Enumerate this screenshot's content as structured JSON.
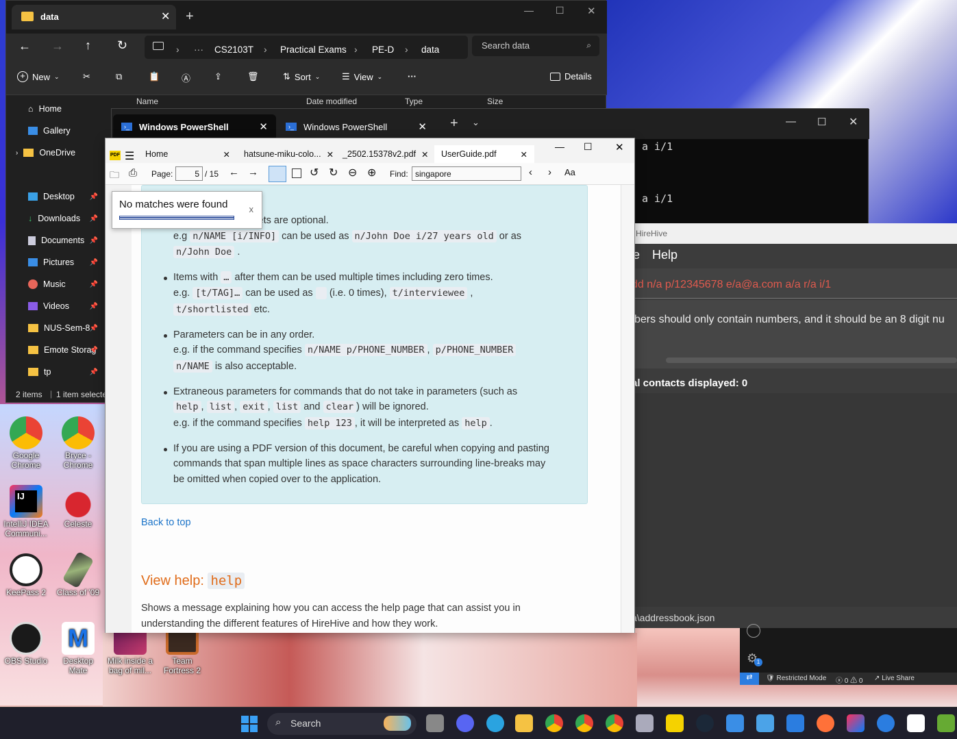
{
  "explorer": {
    "tab_title": "data",
    "breadcrumb": [
      "CS2103T",
      "Practical Exams",
      "PE-D",
      "data"
    ],
    "search_placeholder": "Search data",
    "toolbar": {
      "new": "New",
      "sort": "Sort",
      "view": "View",
      "details": "Details"
    },
    "columns": [
      "Name",
      "Date modified",
      "Type",
      "Size"
    ],
    "sidebar": [
      {
        "label": "Home",
        "icon": "home-icon"
      },
      {
        "label": "Gallery",
        "icon": "gallery-icon"
      },
      {
        "label": "OneDrive",
        "icon": "folder-icon"
      },
      {
        "label": "Desktop",
        "icon": "desktop-icon"
      },
      {
        "label": "Downloads",
        "icon": "download-icon"
      },
      {
        "label": "Documents",
        "icon": "documents-icon"
      },
      {
        "label": "Pictures",
        "icon": "pictures-icon"
      },
      {
        "label": "Music",
        "icon": "music-icon"
      },
      {
        "label": "Videos",
        "icon": "videos-icon"
      },
      {
        "label": "NUS-Sem-8",
        "icon": "folder-icon"
      },
      {
        "label": "Emote Storag",
        "icon": "folder-icon"
      },
      {
        "label": "tp",
        "icon": "folder-icon"
      }
    ],
    "status": {
      "items": "2 items",
      "selected": "1 item selecte"
    }
  },
  "powershell": {
    "tabs": [
      "Windows PowerShell",
      "Windows PowerShell"
    ],
    "lines": [
      "a i/1",
      "a i/1"
    ]
  },
  "hirehive": {
    "title": "HireHive",
    "menu": [
      "e",
      "Help"
    ],
    "command": "dd n/a p/12345678 e/a@a.com a/a r/a i/1",
    "result": "bers should only contain numbers, and it should be an 8 digit nu",
    "count": "al contacts displayed: 0",
    "footer": "a\\addressbook.json"
  },
  "vscode": {
    "restricted": "Restricted Mode",
    "problems": "0 ⚠ 0",
    "live_share": "Live Share",
    "badge": "1"
  },
  "pdf": {
    "tabs": [
      "Home",
      "hatsune-miku-colo...",
      "_2502.15378v2.pdf",
      "UserGuide.pdf"
    ],
    "page_label": "Page:",
    "page_current": "5",
    "page_total": "/ 15",
    "find_label": "Find:",
    "find_value": "singapore",
    "toast": "No matches were found",
    "toast_close": "x",
    "content": {
      "b1_l1": "ckets are optional.",
      "b1_l2_a": "e.g",
      "b1_code1": "n/NAME [i/INFO]",
      "b1_l2_b": "can be used as",
      "b1_code2": "n/John Doe i/27 years old",
      "b1_l2_c": "or as",
      "b1_code3": "n/John Doe",
      "b1_l3_end": ".",
      "b2_l1_a": "Items with",
      "b2_code0": "…",
      "b2_l1_b": "after them can be used multiple times including zero times.",
      "b2_l2_a": "e.g.",
      "b2_code1": "[t/TAG]…",
      "b2_l2_b": "can be used as",
      "b2_l2_c": "(i.e. 0 times),",
      "b2_code2": "t/interviewee",
      "b2_l2_d": ",",
      "b2_code3": "t/shortlisted",
      "b2_l3": "etc.",
      "b3_l1": "Parameters can be in any order.",
      "b3_l2_a": "e.g. if the command specifies",
      "b3_code1": "n/NAME p/PHONE_NUMBER",
      "b3_l2_b": ",",
      "b3_code2": "p/PHONE_NUMBER",
      "b3_code3": "n/NAME",
      "b3_l3": "is also acceptable.",
      "b4_l1": "Extraneous parameters for commands that do not take in parameters (such as",
      "b4_code1": "help",
      "b4_code2": "list",
      "b4_code3": "exit",
      "b4_code4": "list",
      "b4_and": "and",
      "b4_code5": "clear",
      "b4_l2_end": ") will be ignored.",
      "b4_l3_a": "e.g. if the command specifies",
      "b4_code6": "help 123",
      "b4_l3_b": ", it will be interpreted as",
      "b4_code7": "help",
      "b4_l3_end": ".",
      "b5_l1": "If you are using a PDF version of this document, be careful when copying and pasting",
      "b5_l2": "commands that span multiple lines as space characters surrounding line-breaks may",
      "b5_l3": "be omitted when copied over to the application.",
      "back_to_top": "Back to top",
      "heading": "View help:",
      "heading_code": "help",
      "para_l1": "Shows a message explaining how you can access the help page that can assist you in",
      "para_l2": "understanding the different features of HireHive and how they work."
    }
  },
  "desktop_icons": [
    {
      "label": "Google Chrome"
    },
    {
      "label": "Bryce - Chrome"
    },
    {
      "label": "IntelliJ IDEA Communi..."
    },
    {
      "label": "Celeste"
    },
    {
      "label": "KeePass 2"
    },
    {
      "label": "Class of '09"
    },
    {
      "label": "OBS Studio"
    },
    {
      "label": "Desktop Mate"
    },
    {
      "label": "Milk inside a bag of mil..."
    },
    {
      "label": "Team Fortress 2"
    }
  ],
  "taskbar": {
    "search": "Search"
  }
}
